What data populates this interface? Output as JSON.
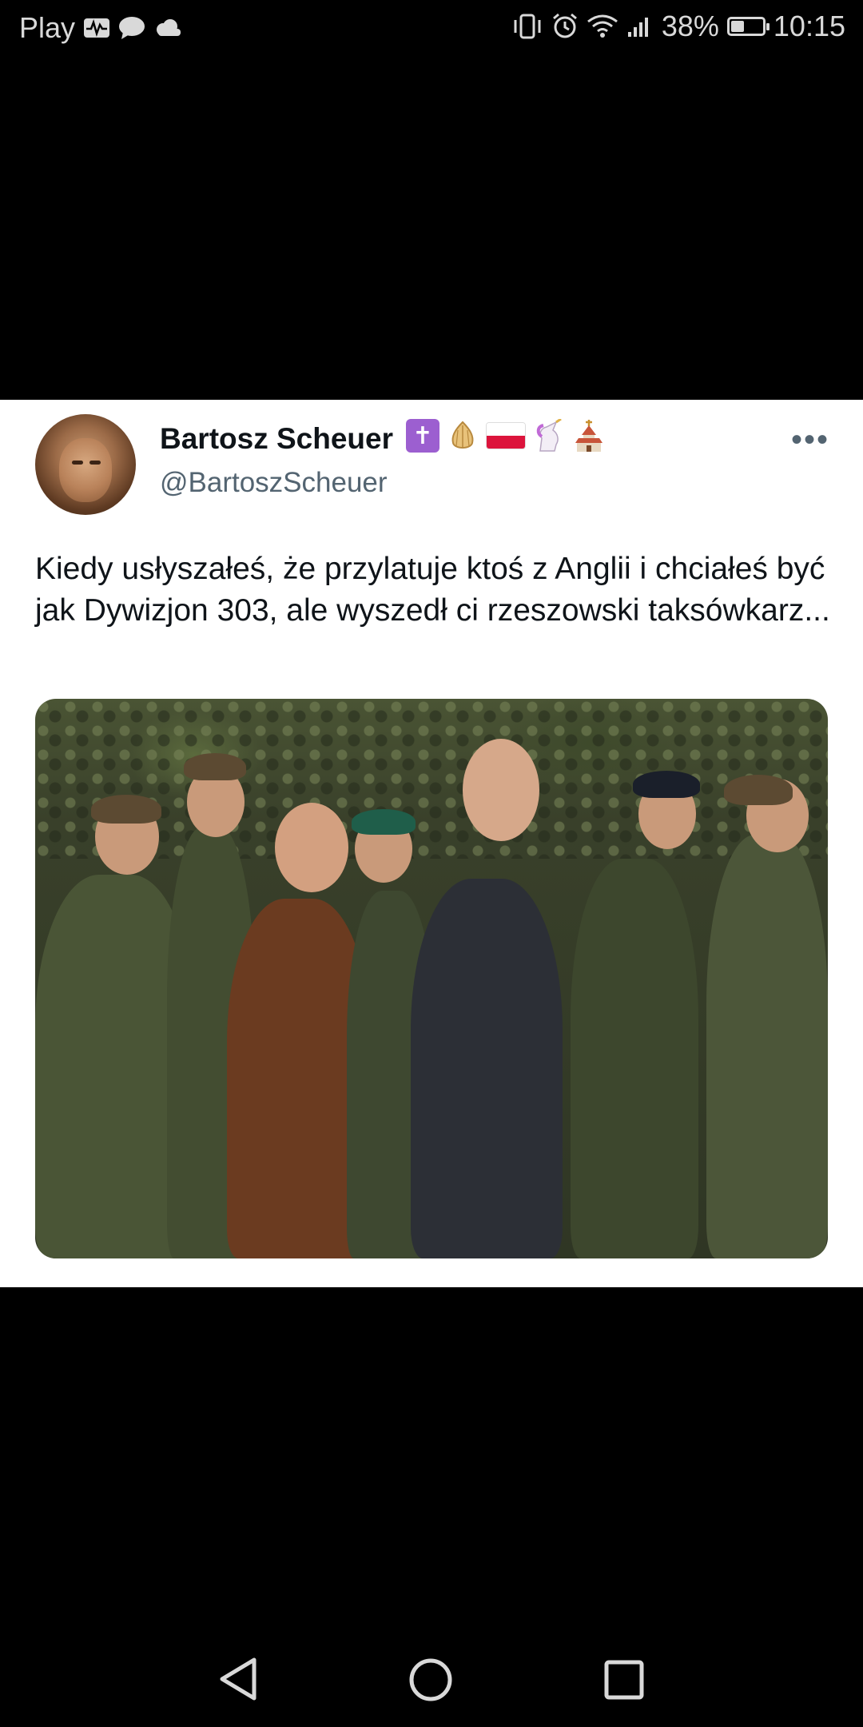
{
  "status_bar": {
    "carrier": "Play",
    "battery_percent_text": "38%",
    "battery_level": 0.38,
    "time": "10:15",
    "left_icons": [
      "activity-icon",
      "chat-icon",
      "cloud-icon"
    ],
    "right_icons": [
      "vibrate-icon",
      "alarm-icon",
      "wifi-icon",
      "signal-icon",
      "battery-icon"
    ]
  },
  "tweet": {
    "author_name": "Bartosz Scheuer",
    "name_emojis": [
      "latin-cross-emoji",
      "onion-emoji",
      "poland-flag-emoji",
      "unicorn-emoji",
      "church-emoji"
    ],
    "handle": "@BartoszScheuer",
    "more_label": "•••",
    "text": "Kiedy usłyszałeś, że przylatuje ktoś z Anglii i chciałeś być jak Dywizjon 303, ale wyszedł ci rzeszowski taksówkarz..."
  },
  "nav_bar": {
    "icons": [
      "back-icon",
      "home-icon",
      "recents-icon"
    ]
  },
  "colors": {
    "background": "#000000",
    "card": "#ffffff",
    "text_primary": "#0f1419",
    "text_secondary": "#536471"
  }
}
